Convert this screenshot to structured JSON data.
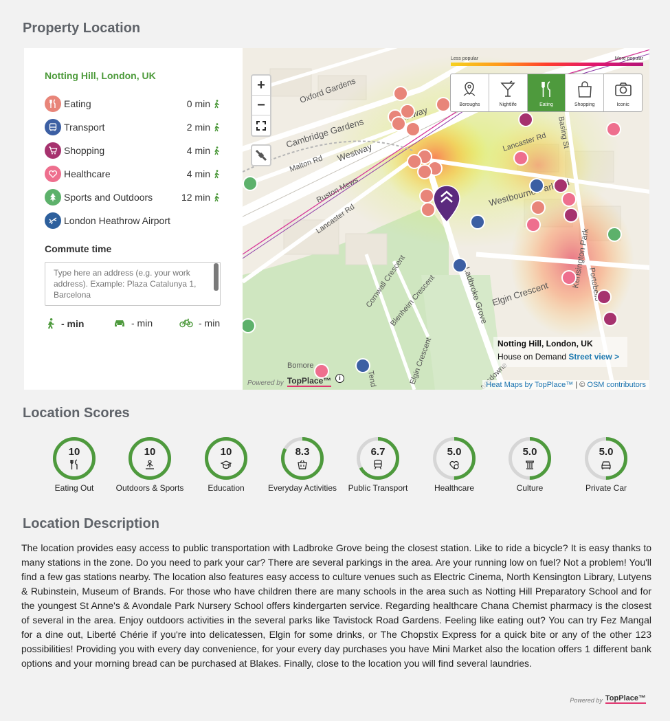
{
  "sections": {
    "location_title": "Property Location",
    "scores_title": "Location Scores",
    "description_title": "Location Description"
  },
  "panel": {
    "location_name": "Notting Hill, London, UK",
    "amenities": [
      {
        "label": "Eating",
        "time": "0 min",
        "icon": "fork-knife-icon",
        "color": "#e88579"
      },
      {
        "label": "Transport",
        "time": "2 min",
        "icon": "bus-icon",
        "color": "#3c5fa3"
      },
      {
        "label": "Shopping",
        "time": "4 min",
        "icon": "shopping-cart-icon",
        "color": "#a6326e"
      },
      {
        "label": "Healthcare",
        "time": "4 min",
        "icon": "heart-icon",
        "color": "#ee6f8e"
      },
      {
        "label": "Sports and Outdoors",
        "time": "12 min",
        "icon": "tree-icon",
        "color": "#5db16b"
      },
      {
        "label": "London Heathrow Airport",
        "time": "",
        "icon": "plane-icon",
        "color": "#2d5f9c"
      }
    ],
    "commute_title": "Commute time",
    "commute_placeholder": "Type here an address (e.g. your work address). Example: Plaza Catalunya 1, Barcelona",
    "modes": {
      "walk": "- min",
      "car": "- min",
      "bike": "- min"
    }
  },
  "map": {
    "zoom_in": "+",
    "zoom_out": "−",
    "legend_less": "Less popular",
    "legend_more": "More popular",
    "categories": [
      {
        "label": "Boroughs",
        "icon": "map-pin-icon"
      },
      {
        "label": "Nightlife",
        "icon": "cocktail-icon"
      },
      {
        "label": "Eating",
        "icon": "fork-knife-icon",
        "active": true
      },
      {
        "label": "Shopping",
        "icon": "shopping-bag-icon"
      },
      {
        "label": "Iconic",
        "icon": "camera-icon"
      }
    ],
    "streets": [
      "Oxford Gardens",
      "Cambridge Gardens",
      "Westway",
      "Malton Rd",
      "Ruston Mews",
      "Lancaster Rd",
      "Westbourne Park Rd",
      "Cornwall Crescent",
      "Blenheim Crescent",
      "Ladbroke Grove",
      "Elgin Crescent",
      "Kensington Park",
      "Basing St",
      "Portobello",
      "Bomore",
      "Elgin Crescent",
      "ansdowne",
      "Tend",
      "Westway",
      "Lancaster Rd"
    ],
    "info_name": "Notting Hill, London, UK",
    "info_desc": "House on Demand",
    "info_link": "Street view >",
    "attribution_heat": "Heat Maps by TopPlace™",
    "attribution_sep": " | © ",
    "attribution_osm": "OSM contributors",
    "powered_by": "Powered by",
    "brand": "TopPlace™",
    "info_icon": "i"
  },
  "scores": [
    {
      "value": 10,
      "display": "10",
      "label": "Eating Out",
      "icon": "fork-knife-icon"
    },
    {
      "value": 10,
      "display": "10",
      "label": "Outdoors & Sports",
      "icon": "person-outdoor-icon"
    },
    {
      "value": 10,
      "display": "10",
      "label": "Education",
      "icon": "graduation-cap-icon"
    },
    {
      "value": 8.3,
      "display": "8.3",
      "label": "Everyday Activities",
      "icon": "basket-icon"
    },
    {
      "value": 6.7,
      "display": "6.7",
      "label": "Public Transport",
      "icon": "train-icon"
    },
    {
      "value": 5.0,
      "display": "5.0",
      "label": "Healthcare",
      "icon": "heart-care-icon"
    },
    {
      "value": 5.0,
      "display": "5.0",
      "label": "Culture",
      "icon": "column-icon"
    },
    {
      "value": 5.0,
      "display": "5.0",
      "label": "Private Car",
      "icon": "car-icon"
    }
  ],
  "score_max": 10,
  "colors": {
    "accent": "#4e9a3d",
    "ring_track": "#d6d6d6"
  },
  "description": "The location provides easy access to public transportation with Ladbroke Grove being the closest station. Like to ride a bicycle? It is easy thanks to many stations in the zone. Do you need to park your car? There are several parkings in the area. Are your running low on fuel? Not a problem! You'll find a few gas stations nearby. The location also features easy access to culture venues such as Electric Cinema, North Kensington Library, Lutyens & Rubinstein, Museum of Brands. For those who have children there are many schools in the area such as Notting Hill Preparatory School and for the youngest St Anne's & Avondale Park Nursery School offers kindergarten service. Regarding healthcare Chana Chemist pharmacy is the closest of several in the area. Enjoy outdoors activities in the several parks like Tavistock Road Gardens. Feeling like eating out? You can try Fez Mangal for a dine out, Liberté Chérie if you're into delicatessen, Elgin for some drinks, or The Chopstix Express for a quick bite or any of the other 123 possibilities! Providing you with every day convenience, for your every day purchases you have Mini Market also the location offers 1 different bank options and your morning bread can be purchased at Blakes. Finally, close to the location you will find several laundries.",
  "footer": {
    "powered_by": "Powered by",
    "brand": "TopPlace™"
  }
}
